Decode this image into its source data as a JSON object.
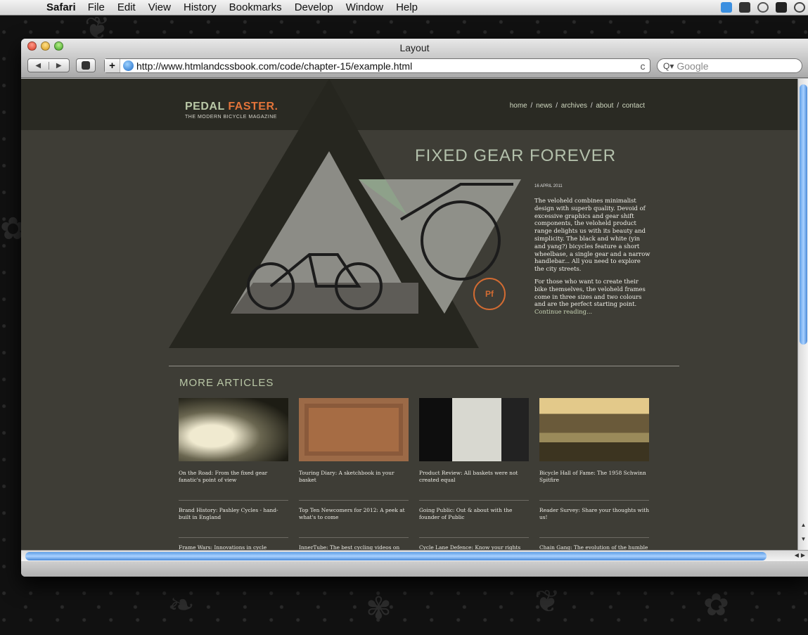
{
  "menubar": {
    "apple_icon": "apple-icon",
    "app_name": "Safari",
    "menus": [
      "File",
      "Edit",
      "View",
      "History",
      "Bookmarks",
      "Develop",
      "Window",
      "Help"
    ],
    "status_icons": [
      "dropbox-icon",
      "evernote-icon",
      "time-machine-icon",
      "display-icon",
      "sync-icon"
    ]
  },
  "window": {
    "title": "Layout",
    "address_url": "http://www.htmlandcssbook.com/code/chapter-15/example.html",
    "search_placeholder": "Google",
    "reload_symbol": "c"
  },
  "site": {
    "logo_primary": "PEDAL",
    "logo_accent": "FASTER.",
    "tagline": "THE MODERN BICYCLE MAGAZINE",
    "nav": [
      "home",
      "news",
      "archives",
      "about",
      "contact"
    ],
    "nav_separator": "/",
    "colors": {
      "accent": "#e3743a",
      "green": "#b9c7a6",
      "bg": "#3e3d36",
      "header": "#2a2a23"
    }
  },
  "hero": {
    "title": "FIXED GEAR FOREVER",
    "date": "16 APRIL 2011",
    "para1": "The veloheld combines minimalist design with superb quality. Devoid of excessive graphics and gear shift components, the veloheld product range delights us with its beauty and simplicity. The black and white (yin and yang?) bicycles feature a short wheelbase, a single gear and a narrow handlebar... All you need to explore the city streets.",
    "para2": "For those who want to create their bike themselves, the veloheld frames come in three sizes and two colours and are the perfect starting point.",
    "continue": "Continue reading...",
    "badge_text": "Pf"
  },
  "more": {
    "title": "MORE ARTICLES",
    "columns": [
      [
        "On the Road: From the fixed gear fanatic's point of view",
        "Brand History: Pashley Cycles - hand-built in England",
        "Frame Wars: Innovations in cycle manufacture and repair"
      ],
      [
        "Touring Diary: A sketchbook in your basket",
        "Top Ten Newcomers for 2012: A peek at what's to come",
        "InnerTube: The best cycling videos on the web"
      ],
      [
        "Product Review: All baskets were not created equal",
        "Going Public: Out & about with the founder of Public",
        "Cycle Lane Defence: Know your rights"
      ],
      [
        "Bicycle Hall of Fame: The 1958 Schwinn Spitfire",
        "Reader Survey: Share your thoughts with us!",
        "Chain Gang: The evolution of the humble bike chain"
      ]
    ]
  }
}
